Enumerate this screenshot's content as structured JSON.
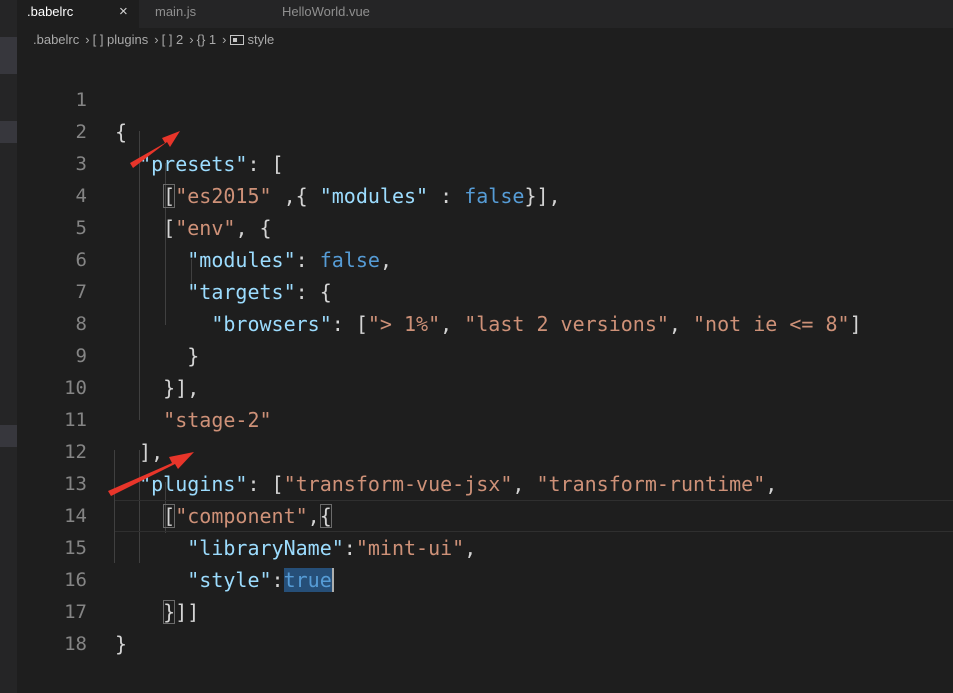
{
  "tabs": [
    {
      "label": ".babelrc",
      "active": true,
      "close": "×"
    },
    {
      "label": "main.js",
      "active": false
    },
    {
      "label": "HelloWorld.vue",
      "active": false
    }
  ],
  "breadcrumb": [
    ".babelrc",
    "[ ] plugins",
    "[ ] 2",
    "{} 1",
    "style"
  ],
  "line_numbers": [
    "1",
    "2",
    "3",
    "4",
    "5",
    "6",
    "7",
    "8",
    "9",
    "10",
    "11",
    "12",
    "13",
    "14",
    "15",
    "16",
    "17",
    "18"
  ],
  "code": {
    "l1": {
      "t0": "{"
    },
    "l2": {
      "t0": "  ",
      "t1": "\"presets\"",
      "t2": ": ["
    },
    "l3": {
      "t0": "    ",
      "t1": "[",
      "t2": "\"es2015\"",
      "t3": " ,{ ",
      "t4": "\"modules\"",
      "t5": " : ",
      "t6": "false",
      "t7": "}],"
    },
    "l4": {
      "t0": "    [",
      "t1": "\"env\"",
      "t2": ", {"
    },
    "l5": {
      "t0": "      ",
      "t1": "\"modules\"",
      "t2": ": ",
      "t3": "false",
      "t4": ","
    },
    "l6": {
      "t0": "      ",
      "t1": "\"targets\"",
      "t2": ": {"
    },
    "l7": {
      "t0": "        ",
      "t1": "\"browsers\"",
      "t2": ": [",
      "t3": "\"> 1%\"",
      "t4": ", ",
      "t5": "\"last 2 versions\"",
      "t6": ", ",
      "t7": "\"not ie <= 8\"",
      "t8": "]"
    },
    "l8": {
      "t0": "      }"
    },
    "l9": {
      "t0": "    }],"
    },
    "l10": {
      "t0": "    ",
      "t1": "\"stage-2\""
    },
    "l11": {
      "t0": "  ],"
    },
    "l12": {
      "t0": "  ",
      "t1": "\"plugins\"",
      "t2": ": [",
      "t3": "\"transform-vue-jsx\"",
      "t4": ", ",
      "t5": "\"transform-runtime\"",
      "t6": ","
    },
    "l13": {
      "t0": "    ",
      "t1": "[",
      "t2": "\"component\"",
      "t3": ",",
      "t4": "{"
    },
    "l14": {
      "t0": "      ",
      "t1": "\"libraryName\"",
      "t2": ":",
      "t3": "\"mint-ui\"",
      "t4": ","
    },
    "l15": {
      "t0": "      ",
      "t1": "\"style\"",
      "t2": ":",
      "t3": "true"
    },
    "l16": {
      "t0": "    ",
      "t1": "}",
      "t2": "]]"
    },
    "l17": {
      "t0": "}"
    },
    "l18": {
      "t0": ""
    }
  },
  "colors": {
    "background": "#1e1e1e",
    "key": "#9cdcfe",
    "string": "#ce9178",
    "boolean": "#569cd6",
    "annotation_arrow": "#e8352a"
  }
}
